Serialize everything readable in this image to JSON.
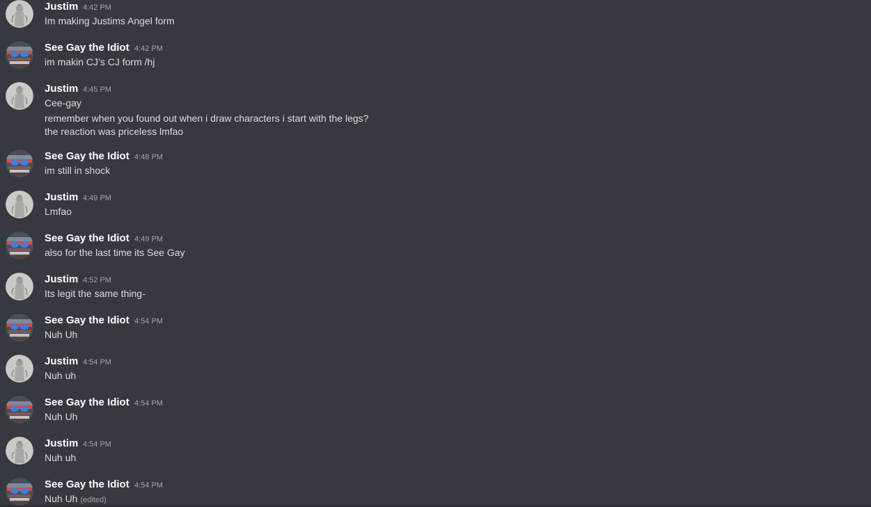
{
  "messages": [
    {
      "author": "Justim",
      "time": "4:42 PM",
      "lines": [
        "Im making Justims Angel form"
      ],
      "avatar": "justim-avatar"
    },
    {
      "author": "See Gay the Idiot",
      "time": "4:42 PM",
      "lines": [
        "im makin CJ’s CJ form /hj"
      ],
      "avatar": "seegay-avatar"
    },
    {
      "author": "Justim",
      "time": "4:45 PM",
      "lines": [
        "Cee-gay",
        "remember when you found out when i draw characters i start with the legs?",
        "the reaction was priceless lmfao"
      ],
      "avatar": "justim-avatar"
    },
    {
      "author": "See Gay the Idiot",
      "time": "4:48 PM",
      "lines": [
        "im still in shock"
      ],
      "avatar": "seegay-avatar"
    },
    {
      "author": "Justim",
      "time": "4:49 PM",
      "lines": [
        "Lmfao"
      ],
      "avatar": "justim-avatar"
    },
    {
      "author": "See Gay the Idiot",
      "time": "4:49 PM",
      "lines": [
        "also for the last time its See Gay"
      ],
      "avatar": "seegay-avatar"
    },
    {
      "author": "Justim",
      "time": "4:52 PM",
      "lines": [
        "Its legit the same thing-"
      ],
      "avatar": "justim-avatar"
    },
    {
      "author": "See Gay the Idiot",
      "time": "4:54 PM",
      "lines": [
        "Nuh Uh"
      ],
      "avatar": "seegay-avatar"
    },
    {
      "author": "Justim",
      "time": "4:54 PM",
      "lines": [
        "Nuh uh"
      ],
      "avatar": "justim-avatar"
    },
    {
      "author": "See Gay the Idiot",
      "time": "4:54 PM",
      "lines": [
        "Nuh Uh"
      ],
      "avatar": "seegay-avatar"
    },
    {
      "author": "Justim",
      "time": "4:54 PM",
      "lines": [
        "Nuh uh"
      ],
      "avatar": "justim-avatar"
    },
    {
      "author": "See Gay the Idiot",
      "time": "4:54 PM",
      "lines": [
        "Nuh Uh"
      ],
      "edited": "(edited)",
      "avatar": "seegay-avatar"
    }
  ],
  "colors": {
    "background": "#36393f",
    "username": "#ffffff",
    "message_text": "#dcddde",
    "timestamp": "#a3a6aa"
  }
}
